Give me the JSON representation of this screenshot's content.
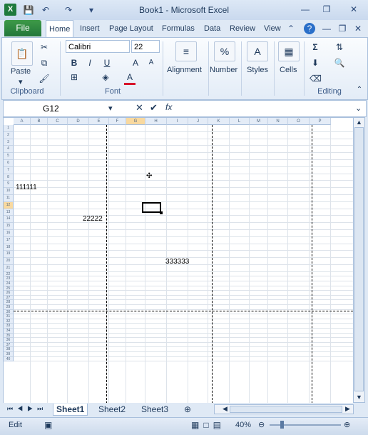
{
  "window": {
    "title": "Book1  -  Microsoft Excel",
    "min_glyph": "—",
    "restore_glyph": "❐",
    "close_glyph": "✕"
  },
  "tabs": {
    "file": "File",
    "items": [
      "Home",
      "Insert",
      "Page Layout",
      "Formulas",
      "Data",
      "Review",
      "View"
    ]
  },
  "ribbon": {
    "clipboard": {
      "label": "Clipboard",
      "paste": "Paste"
    },
    "font": {
      "label": "Font",
      "name": "Calibri",
      "size": "22",
      "bold": "B",
      "italic": "I",
      "underline": "U"
    },
    "alignment": {
      "label": "Alignment"
    },
    "number": {
      "label": "Number",
      "icon": "%"
    },
    "styles": {
      "label": "Styles"
    },
    "cells": {
      "label": "Cells"
    },
    "editing": {
      "label": "Editing",
      "sum": "Σ"
    }
  },
  "formula_bar": {
    "name_box": "G12",
    "cancel": "✕",
    "enter": "✔",
    "fx": "fx",
    "content": ""
  },
  "sheet": {
    "columns": [
      "A",
      "B",
      "C",
      "D",
      "E",
      "F",
      "G",
      "H",
      "I",
      "J",
      "K",
      "L",
      "M",
      "N",
      "O",
      "P"
    ],
    "rows": [
      "1",
      "2",
      "3",
      "4",
      "5",
      "6",
      "7",
      "8",
      "9",
      "10",
      "11",
      "12",
      "13",
      "14",
      "15",
      "16",
      "17",
      "18",
      "19",
      "20",
      "21",
      "22",
      "23",
      "24",
      "25",
      "26",
      "27",
      "28",
      "29",
      "30",
      "31",
      "32",
      "33",
      "34",
      "35",
      "36",
      "37",
      "38",
      "39",
      "40"
    ],
    "cells": {
      "A10": "111111",
      "D12": "22222",
      "H17": "333333"
    },
    "selected_cell": "G12"
  },
  "sheet_tabs": {
    "items": [
      "Sheet1",
      "Sheet2",
      "Sheet3"
    ],
    "active": "Sheet1"
  },
  "status": {
    "mode": "Edit",
    "zoom": "40%"
  }
}
